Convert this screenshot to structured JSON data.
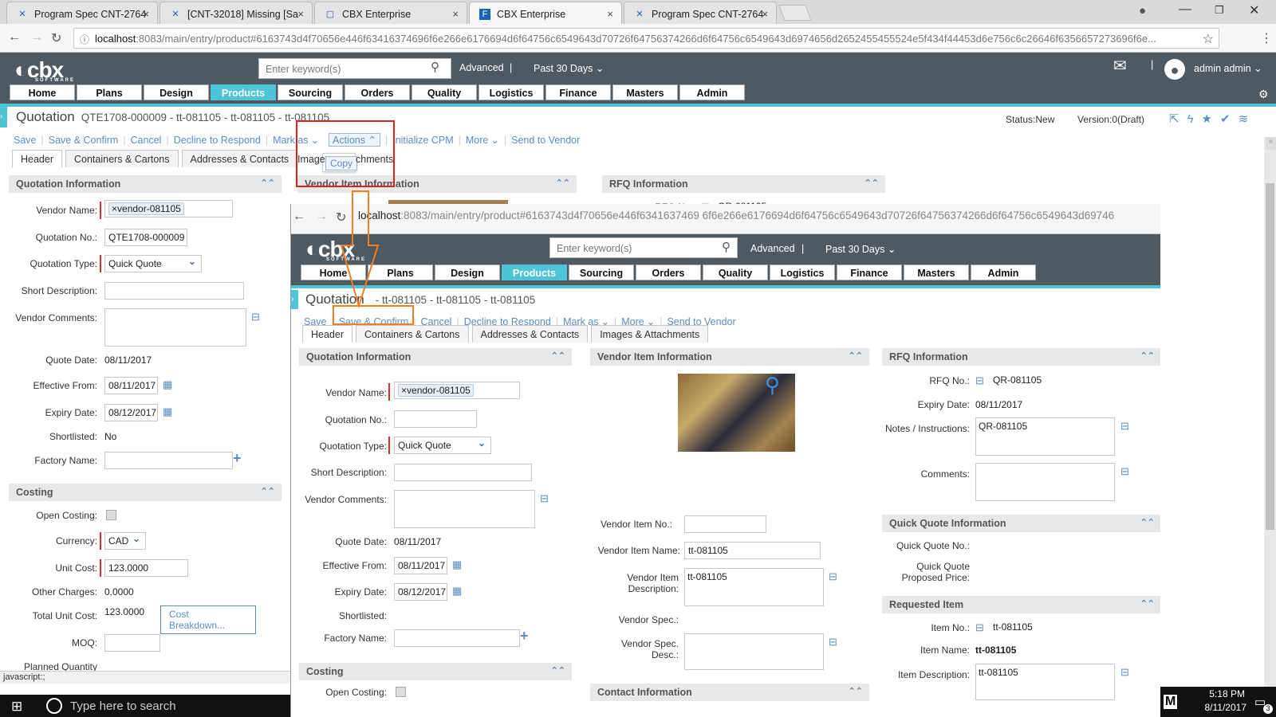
{
  "browser": {
    "tabs": [
      {
        "label": "Program Spec CNT-2764",
        "icon": "jira-icon"
      },
      {
        "label": "[CNT-32018] Missing [Sa",
        "icon": "jira-icon"
      },
      {
        "label": "CBX Enterprise",
        "icon": "page-icon"
      },
      {
        "label": "CBX Enterprise",
        "icon": "cbx-icon"
      },
      {
        "label": "Program Spec CNT-2764",
        "icon": "jira-icon"
      }
    ],
    "url_host": "localhost",
    "url_rest": ":8083/main/entry/product#6163743d4f70656e446f63416374696f6e266e6176694d6f64756c6549643d70726f64756374266d6f64756c6549643d6974656d2652455455524e5f434f44453d6e756c6c26646f6356657273696f6e...",
    "overlay_url_host": "localhost",
    "overlay_url_rest": ":8083/main/entry/product#6163743d4f70656e446f6341637469 6f6e266e6176694d6f64756c6549643d70726f64756374266d6f64756c6549643d69746"
  },
  "header": {
    "search_placeholder": "Enter keyword(s)",
    "advanced": "Advanced",
    "pipe": "|",
    "period": "Past 30 Days",
    "user": "admin admin",
    "nav": [
      "Home",
      "Plans",
      "Design",
      "Products",
      "Sourcing",
      "Orders",
      "Quality",
      "Logistics",
      "Finance",
      "Masters",
      "Admin"
    ],
    "active_nav": "Products"
  },
  "doc": {
    "title": "Quotation",
    "subtitle": "QTE1708-000009 - tt-081105 - tt-081105 - tt-081105",
    "status": "Status:New",
    "version": "Version:0(Draft)",
    "toolbar": [
      "Save",
      "Save & Confirm",
      "Cancel",
      "Decline to Respond",
      "Mark as",
      "Actions",
      "Initialize CPM",
      "More",
      "Send to Vendor"
    ],
    "actions_menu": [
      "Copy"
    ],
    "tabs": [
      "Header",
      "Containers & Cartons",
      "Addresses & Contacts",
      "Images & Attachments"
    ],
    "tab_partial_1": "Image",
    "tab_partial_2": "chments"
  },
  "left": {
    "section_quotation": "Quotation Information",
    "vendor_name_label": "Vendor Name:",
    "vendor_name": "vendor-081105",
    "quotation_no_label": "Quotation No.:",
    "quotation_no": "QTE1708-000009",
    "quotation_type_label": "Quotation Type:",
    "quotation_type": "Quick Quote",
    "short_desc_label": "Short Description:",
    "vendor_comments_label": "Vendor Comments:",
    "quote_date_label": "Quote Date:",
    "quote_date": "08/11/2017",
    "effective_from_label": "Effective From:",
    "effective_from": "08/11/2017",
    "expiry_date_label": "Expiry Date:",
    "expiry_date": "08/12/2017",
    "shortlisted_label": "Shortlisted:",
    "shortlisted": "No",
    "factory_name_label": "Factory Name:",
    "section_costing": "Costing",
    "open_costing_label": "Open Costing:",
    "currency_label": "Currency:",
    "currency": "CAD",
    "unit_cost_label": "Unit Cost:",
    "unit_cost": "123.0000",
    "other_charges_label": "Other Charges:",
    "other_charges": "0.0000",
    "total_unit_cost_label": "Total Unit Cost:",
    "total_unit_cost": "123.0000",
    "cost_breakdown": "Cost Breakdown...",
    "moq_label": "MOQ:",
    "planned_qty_label": "Planned Quantity"
  },
  "bg_sections": {
    "vendor_item": "Vendor Item Information",
    "rfq": "RFQ Information",
    "rfq_no_label": "RFQ No.:",
    "rfq_no": "QR-081105"
  },
  "overlay": {
    "subtitle": "- tt-081105 - tt-081105 - tt-081105",
    "toolbar": [
      "Save",
      "Save & Confirm",
      "Cancel",
      "Decline to Respond",
      "Mark as",
      "More",
      "Send to Vendor"
    ],
    "quotation_no": "",
    "vendor_item": {
      "vendor_item_no_label": "Vendor Item No.:",
      "vendor_item_name_label": "Vendor Item Name:",
      "vendor_item_name": "tt-081105",
      "vendor_item_desc_label": "Vendor Item Description:",
      "vendor_item_desc": "tt-081105",
      "vendor_spec_label": "Vendor Spec.:",
      "vendor_spec_desc_label": "Vendor Spec. Desc.:",
      "contact_section": "Contact Information"
    },
    "rfq": {
      "expiry_label": "Expiry Date:",
      "expiry": "08/11/2017",
      "notes_label": "Notes / Instructions:",
      "notes": "QR-081105",
      "comments_label": "Comments:",
      "quick_quote_section": "Quick Quote Information",
      "quick_quote_no_label": "Quick Quote No.:",
      "quick_quote_price_label": "Quick Quote Proposed Price:",
      "requested_item_section": "Requested Item",
      "item_no_label": "Item No.:",
      "item_no": "tt-081105",
      "item_name_label": "Item Name:",
      "item_name": "tt-081105",
      "item_desc_label": "Item Description:",
      "item_desc": "tt-081105"
    }
  },
  "statusbar": "javascript:;",
  "taskbar": {
    "search": "Type here to search",
    "time": "5:18 PM",
    "date": "8/11/2017",
    "badge": "3",
    "app_letter": "M"
  },
  "colors": {
    "accent": "#4ec5d6",
    "header": "#4f5962",
    "link": "#5b8cc2",
    "highlight_red": "#e02020",
    "highlight_orange": "#f07f22"
  }
}
